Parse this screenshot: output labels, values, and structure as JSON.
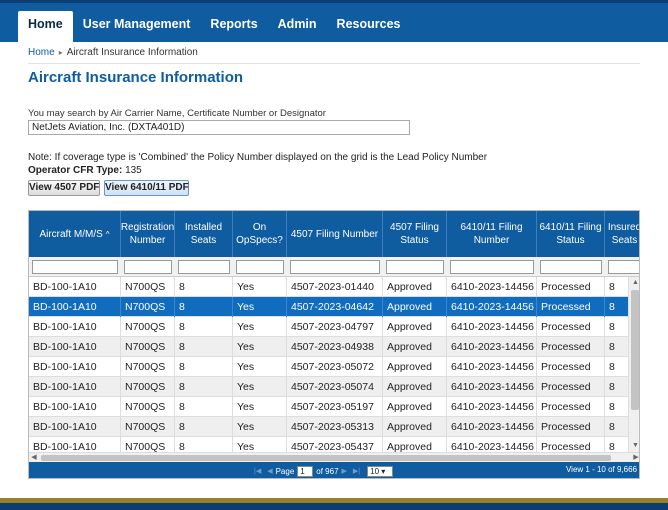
{
  "nav": {
    "tabs": [
      {
        "label": "Home",
        "active": true
      },
      {
        "label": "User Management",
        "active": false
      },
      {
        "label": "Reports",
        "active": false
      },
      {
        "label": "Admin",
        "active": false
      },
      {
        "label": "Resources",
        "active": false
      }
    ]
  },
  "breadcrumb": {
    "home": "Home",
    "separator": "▸",
    "current": "Aircraft Insurance Information"
  },
  "page_title": "Aircraft Insurance Information",
  "search": {
    "label": "You may search by Air Carrier Name, Certificate Number or Designator",
    "value": "NetJets Aviation, Inc. (DXTA401D)"
  },
  "note": "Note: If coverage type is 'Combined' the Policy Number displayed on the grid is the Lead Policy Number",
  "cfr": {
    "label": "Operator CFR Type:",
    "value": "135"
  },
  "buttons": {
    "view4507": "View 4507 PDF",
    "view6410": "View 6410/11 PDF"
  },
  "grid": {
    "columns": [
      "Aircraft M/M/S",
      "Registration Number",
      "Installed Seats",
      "On OpSpecs?",
      "4507 Filing Number",
      "4507 Filing Status",
      "6410/11 Filing Number",
      "6410/11 Filing Status",
      "Insured Seats"
    ],
    "sort_indicator": "^",
    "selected_row": 1,
    "rows": [
      [
        "BD-100-1A10",
        "N700QS",
        "8",
        "Yes",
        "4507-2023-01440",
        "Approved",
        "6410-2023-14456",
        "Processed",
        "8"
      ],
      [
        "BD-100-1A10",
        "N700QS",
        "8",
        "Yes",
        "4507-2023-04642",
        "Approved",
        "6410-2023-14456",
        "Processed",
        "8"
      ],
      [
        "BD-100-1A10",
        "N700QS",
        "8",
        "Yes",
        "4507-2023-04797",
        "Approved",
        "6410-2023-14456",
        "Processed",
        "8"
      ],
      [
        "BD-100-1A10",
        "N700QS",
        "8",
        "Yes",
        "4507-2023-04938",
        "Approved",
        "6410-2023-14456",
        "Processed",
        "8"
      ],
      [
        "BD-100-1A10",
        "N700QS",
        "8",
        "Yes",
        "4507-2023-05072",
        "Approved",
        "6410-2023-14456",
        "Processed",
        "8"
      ],
      [
        "BD-100-1A10",
        "N700QS",
        "8",
        "Yes",
        "4507-2023-05074",
        "Approved",
        "6410-2023-14456",
        "Processed",
        "8"
      ],
      [
        "BD-100-1A10",
        "N700QS",
        "8",
        "Yes",
        "4507-2023-05197",
        "Approved",
        "6410-2023-14456",
        "Processed",
        "8"
      ],
      [
        "BD-100-1A10",
        "N700QS",
        "8",
        "Yes",
        "4507-2023-05313",
        "Approved",
        "6410-2023-14456",
        "Processed",
        "8"
      ],
      [
        "BD-100-1A10",
        "N700QS",
        "8",
        "Yes",
        "4507-2023-05437",
        "Approved",
        "6410-2023-14456",
        "Processed",
        "8"
      ]
    ]
  },
  "pager": {
    "page_label": "Page",
    "page_value": "1",
    "of_label": "of 967",
    "page_size": "10",
    "view_text": "View 1 - 10 of 9,666"
  },
  "colors": {
    "nav_blue": "#0f5ca1",
    "selected_row": "#0f6cbf",
    "footer_gold": "#9a7f2a"
  }
}
